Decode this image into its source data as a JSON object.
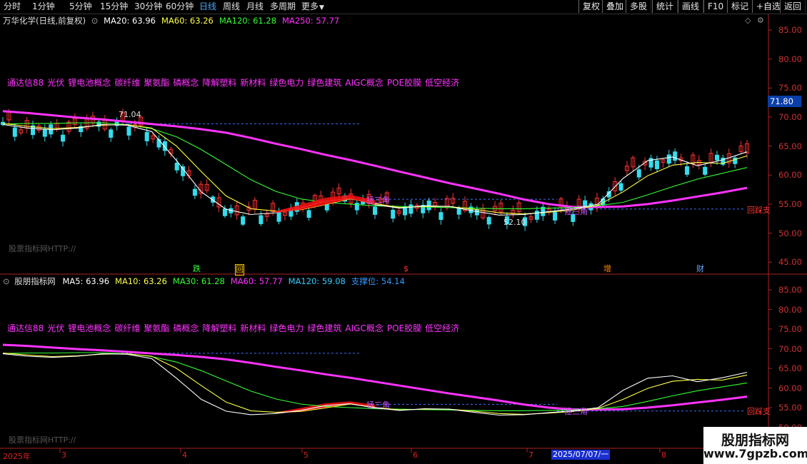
{
  "toolbar": {
    "timeframes": [
      "分时",
      "1分钟",
      "5分钟",
      "15分钟",
      "30分钟",
      "60分钟",
      "日线",
      "周线",
      "月线",
      "多周期",
      "更多"
    ],
    "active_index": 6,
    "right_buttons": [
      "复权",
      "叠加",
      "多股",
      "统计",
      "画线",
      "F10",
      "标记",
      "+自选",
      "返回"
    ]
  },
  "main": {
    "title": "万华化学(日线,前复权)",
    "ma": [
      {
        "label": "MA20: 63.96",
        "color": "#ffffff"
      },
      {
        "label": "MA60: 63.26",
        "color": "#ffff44"
      },
      {
        "label": "MA120: 61.28",
        "color": "#33ff33"
      },
      {
        "label": "MA250: 57.77",
        "color": "#ff33ff"
      }
    ],
    "concepts": [
      "通达信88",
      "光伏",
      "锂电池概念",
      "碳纤维",
      "聚氨酯",
      "磷概念",
      "降解塑料",
      "新材料",
      "绿色电力",
      "绿色建筑",
      "AIGC概念",
      "POE胶膜",
      "低空经济"
    ],
    "watermark": "股票指标网HTTP://",
    "high_label": "71.04",
    "low_label": "52.10",
    "price_tag": "71.80",
    "support_label": "回踩支",
    "zone_label": "拯三角",
    "y_ticks": [
      "85.00",
      "80.00",
      "75.00",
      "70.00",
      "65.00",
      "60.00",
      "55.00",
      "50.00",
      "45.00"
    ],
    "markers": [
      {
        "text": "跌",
        "color": "#33ff33"
      },
      {
        "text": "回",
        "color": "#ffcc00"
      },
      {
        "text": "$",
        "color": "#ff3333"
      },
      {
        "text": "增",
        "color": "#ff8800"
      },
      {
        "text": "财",
        "color": "#66aaff"
      }
    ]
  },
  "sub": {
    "title": "股朋指标网",
    "ma": [
      {
        "label": "MA5: 63.96",
        "color": "#ffffff"
      },
      {
        "label": "MA10: 63.26",
        "color": "#ffff44"
      },
      {
        "label": "MA30: 61.28",
        "color": "#33ff33"
      },
      {
        "label": "MA60: 57.77",
        "color": "#ff33ff"
      },
      {
        "label": "MA120: 59.08",
        "color": "#33ccff"
      },
      {
        "label": "支撑位: 54.14",
        "color": "#3399ff"
      }
    ],
    "concepts": [
      "通达信88",
      "光伏",
      "锂电池概念",
      "碳纤维",
      "聚氨酯",
      "磷概念",
      "降解塑料",
      "新材料",
      "绿色电力",
      "绿色建筑",
      "AIGC概念",
      "POE胶膜",
      "低空经济"
    ],
    "watermark": "股票指标网HTTP://",
    "support_label": "回踩支",
    "zone_label": "拯三角",
    "y_ticks": [
      "85.00",
      "80.00",
      "75.00",
      "70.00",
      "65.00",
      "60.00",
      "55.00",
      "50.00"
    ]
  },
  "dates": {
    "year": "2025年",
    "months": [
      "3",
      "4",
      "5",
      "6",
      "7",
      "8"
    ],
    "cursor": "2025/07/07/一"
  },
  "brand": {
    "name": "股朋指标网",
    "url": "www.7gpzb.com"
  },
  "chart_data": {
    "type": "line",
    "title": "万华化学(日线,前复权)",
    "y_unit": "price",
    "ylim": [
      43,
      88
    ],
    "x_start": "2025-02-24",
    "x_end": "2025-08-18",
    "series": [
      {
        "name": "MA250",
        "color": "#ff33ff",
        "values": [
          71.0,
          70.7,
          70.3,
          69.9,
          69.6,
          69.2,
          68.8,
          68.4,
          67.9,
          67.3,
          66.4,
          65.4,
          64.5,
          63.5,
          62.6,
          61.6,
          60.6,
          59.6,
          58.6,
          57.7,
          56.8,
          55.8,
          55.0,
          54.5,
          54.5,
          54.6,
          55.0,
          55.6,
          56.3,
          57.0,
          57.8
        ]
      },
      {
        "name": "MA120",
        "color": "#33ff33",
        "values": [
          68.8,
          68.9,
          68.9,
          69.0,
          69.0,
          68.7,
          68.0,
          66.6,
          64.4,
          61.8,
          59.2,
          57.2,
          55.9,
          55.3,
          55.0,
          54.7,
          54.6,
          54.5,
          54.4,
          54.3,
          54.2,
          54.2,
          54.3,
          54.4,
          54.7,
          55.3,
          56.6,
          58.0,
          59.3,
          60.3,
          61.3
        ]
      },
      {
        "name": "MA60",
        "color": "#ffff44",
        "values": [
          68.9,
          68.4,
          68.0,
          68.2,
          68.6,
          68.7,
          68.1,
          65.0,
          60.6,
          56.4,
          54.2,
          53.8,
          54.0,
          54.9,
          55.9,
          55.1,
          54.4,
          54.6,
          54.6,
          54.1,
          53.5,
          53.3,
          53.6,
          54.0,
          54.8,
          57.1,
          59.9,
          61.7,
          62.2,
          62.0,
          63.3
        ]
      },
      {
        "name": "MA20",
        "color": "#ffffff",
        "values": [
          68.7,
          68.1,
          67.8,
          68.1,
          68.7,
          68.6,
          67.5,
          62.5,
          57.1,
          54.1,
          53.2,
          53.5,
          54.3,
          55.5,
          56.0,
          54.9,
          54.3,
          54.7,
          54.6,
          53.8,
          53.1,
          53.2,
          53.7,
          54.2,
          55.0,
          59.4,
          62.5,
          63.1,
          61.6,
          62.6,
          64.0
        ]
      }
    ],
    "annotations": [
      {
        "text": "71.04",
        "value": 71.04,
        "note": "period high"
      },
      {
        "text": "52.10",
        "value": 52.1,
        "note": "period low"
      },
      {
        "text": "71.80",
        "value": 71.8,
        "note": "price tag"
      },
      {
        "text": "支撑位",
        "value": 54.14
      }
    ]
  }
}
